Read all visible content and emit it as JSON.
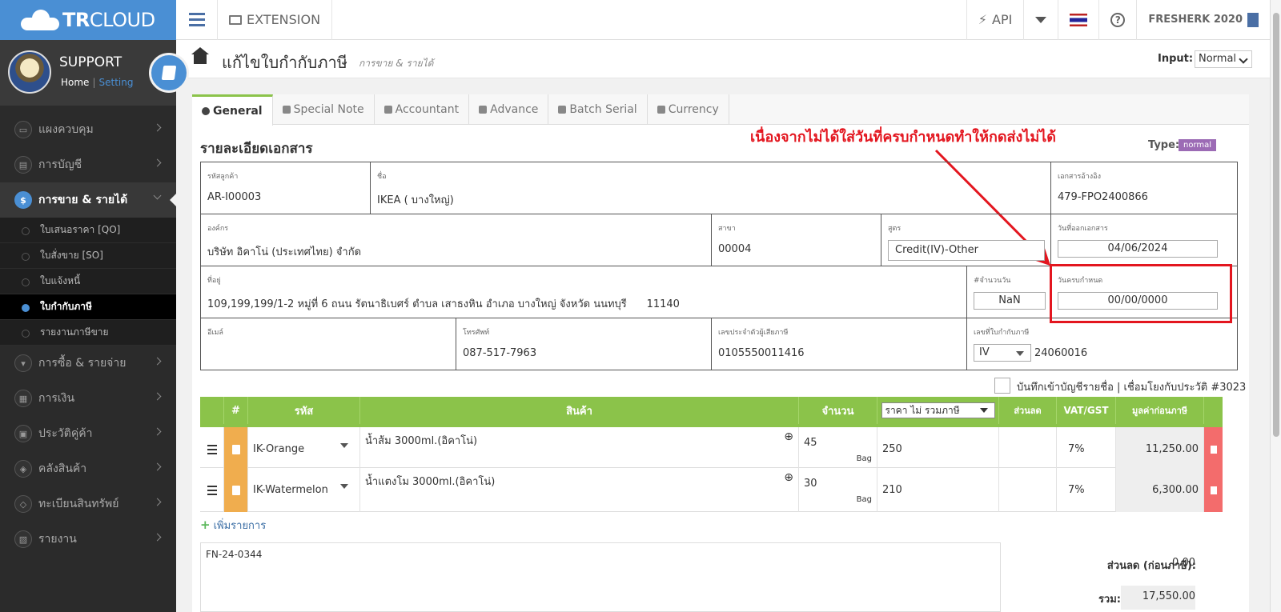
{
  "brand": {
    "bold": "TR",
    "thin": "CLOUD"
  },
  "profile": {
    "name": "SUPPORT",
    "home": "Home",
    "sep": "|",
    "setting": "Setting"
  },
  "menu": [
    {
      "label": "แผงควบคุม",
      "icon": "monitor-icon"
    },
    {
      "label": "การบัญชี",
      "icon": "book-icon"
    },
    {
      "label": "การขาย & รายได้",
      "icon": "dollar-icon",
      "active": true
    },
    {
      "label": "การซื้อ & รายจ่าย",
      "icon": "cart-icon"
    },
    {
      "label": "การเงิน",
      "icon": "calendar-icon"
    },
    {
      "label": "ประวัติคู่ค้า",
      "icon": "contact-icon"
    },
    {
      "label": "คลังสินค้า",
      "icon": "cubes-icon"
    },
    {
      "label": "ทะเบียนสินทรัพย์",
      "icon": "diamond-icon"
    },
    {
      "label": "รายงาน",
      "icon": "report-icon"
    }
  ],
  "submenu": [
    "ใบเสนอราคา [QO]",
    "ใบสั่งขาย [SO]",
    "ใบแจ้งหนี้",
    "ใบกำกับภาษี",
    "รายงานภาษีขาย"
  ],
  "topbar": {
    "extension": "EXTENSION",
    "api": "API",
    "user": "FRESHERK 2020"
  },
  "page": {
    "title": "แก้ไขใบกำกับภาษี",
    "crumb": "การขาย & รายได้",
    "input_label": "Input:",
    "input_value": "Normal"
  },
  "tabs": [
    "General",
    "Special Note",
    "Accountant",
    "Advance",
    "Batch Serial",
    "Currency"
  ],
  "section_title": "รายละเอียดเอกสาร",
  "type_label": "Type:",
  "type_value": "normal",
  "annotation": "เนื่องจากไม่ได้ใส่วันที่ครบกำหนดทำให้กดส่งไม่ได้",
  "doc": {
    "customer_code_lbl": "รหัสลูกค้า",
    "customer_code": "AR-I00003",
    "name_lbl": "ชื่อ",
    "name": "IKEA ( บางใหญ่)",
    "ref_lbl": "เอกสารอ้างอิง",
    "ref": "479-FPO2400866",
    "org_lbl": "องค์กร",
    "org": "บริษัท อิคาโน่ (ประเทศไทย) จำกัด",
    "branch_lbl": "สาขา",
    "branch": "00004",
    "formula_lbl": "สูตร",
    "formula": "Credit(IV)-Other",
    "issue_lbl": "วันที่ออกเอกสาร",
    "issue": "04/06/2024",
    "addr_lbl": "ที่อยู่",
    "addr": "109,199,199/1-2 หมู่ที่ 6 ถนน รัตนาธิเบศร์ ตำบล เสาธงหิน อำเภอ บางใหญ่ จังหวัด นนทบุรี      11140",
    "days_lbl": "#จำนวนวัน",
    "days": "NaN",
    "due_lbl": "วันครบกำหนด",
    "due": "00/00/0000",
    "email_lbl": "อีเมล์",
    "email": "",
    "phone_lbl": "โทรศัพท์",
    "phone": "087-517-7963",
    "tax_lbl": "เลขประจำตัวผู้เสียภาษี",
    "tax": "0105550011416",
    "inv_lbl": "เลขที่ใบกำกับภาษี",
    "inv_prefix": "IV",
    "inv_no": "24060016"
  },
  "checkbox_label": "บันทึกเข้าบัญชีรายชื่อ | เชื่อมโยงกับประวัติ #3023",
  "item_headers": {
    "num": "#",
    "code": "รหัส",
    "product": "สินค้า",
    "qty": "จำนวน",
    "price_mode": "ราคา ไม่ รวมภาษี",
    "discount": "ส่วนลด",
    "vat": "VAT/GST",
    "amount": "มูลค่าก่อนภาษี"
  },
  "items": [
    {
      "code": "IK-Orange",
      "desc": "น้ำส้ม  3000ml.(อิคาโน่)",
      "qty": "45",
      "unit": "Bag",
      "price": "250",
      "vat": "7%",
      "amount": "11,250.00"
    },
    {
      "code": "IK-Watermelon",
      "desc": "น้ำแตงโม  3000ml.(อิคาโน่)",
      "qty": "30",
      "unit": "Bag",
      "price": "210",
      "vat": "7%",
      "amount": "6,300.00"
    }
  ],
  "add_row": "เพิ่มรายการ",
  "note": "FN-24-0344",
  "summary": {
    "discount_lbl": "ส่วนลด (ก่อนภาษี):",
    "discount": "0.00",
    "total_lbl": "รวม:",
    "total": "17,550.00"
  }
}
